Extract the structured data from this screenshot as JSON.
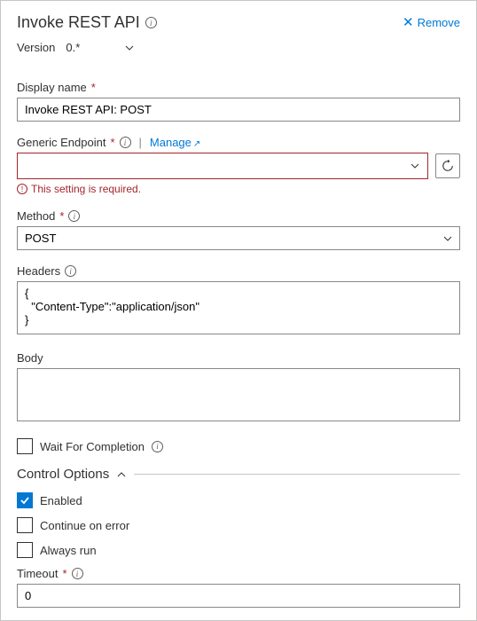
{
  "header": {
    "title": "Invoke REST API",
    "remove_label": "Remove"
  },
  "version": {
    "label": "Version",
    "value": "0.*"
  },
  "fields": {
    "display_name": {
      "label": "Display name",
      "value": "Invoke REST API: POST"
    },
    "endpoint": {
      "label": "Generic Endpoint",
      "manage_label": "Manage",
      "error": "This setting is required."
    },
    "method": {
      "label": "Method",
      "value": "POST"
    },
    "headers": {
      "label": "Headers",
      "value": "{\n  \"Content-Type\":\"application/json\"\n}"
    },
    "body": {
      "label": "Body",
      "value": ""
    },
    "wait": {
      "label": "Wait For Completion"
    }
  },
  "control_options": {
    "title": "Control Options",
    "enabled_label": "Enabled",
    "continue_label": "Continue on error",
    "always_run_label": "Always run",
    "timeout_label": "Timeout",
    "timeout_value": "0"
  }
}
